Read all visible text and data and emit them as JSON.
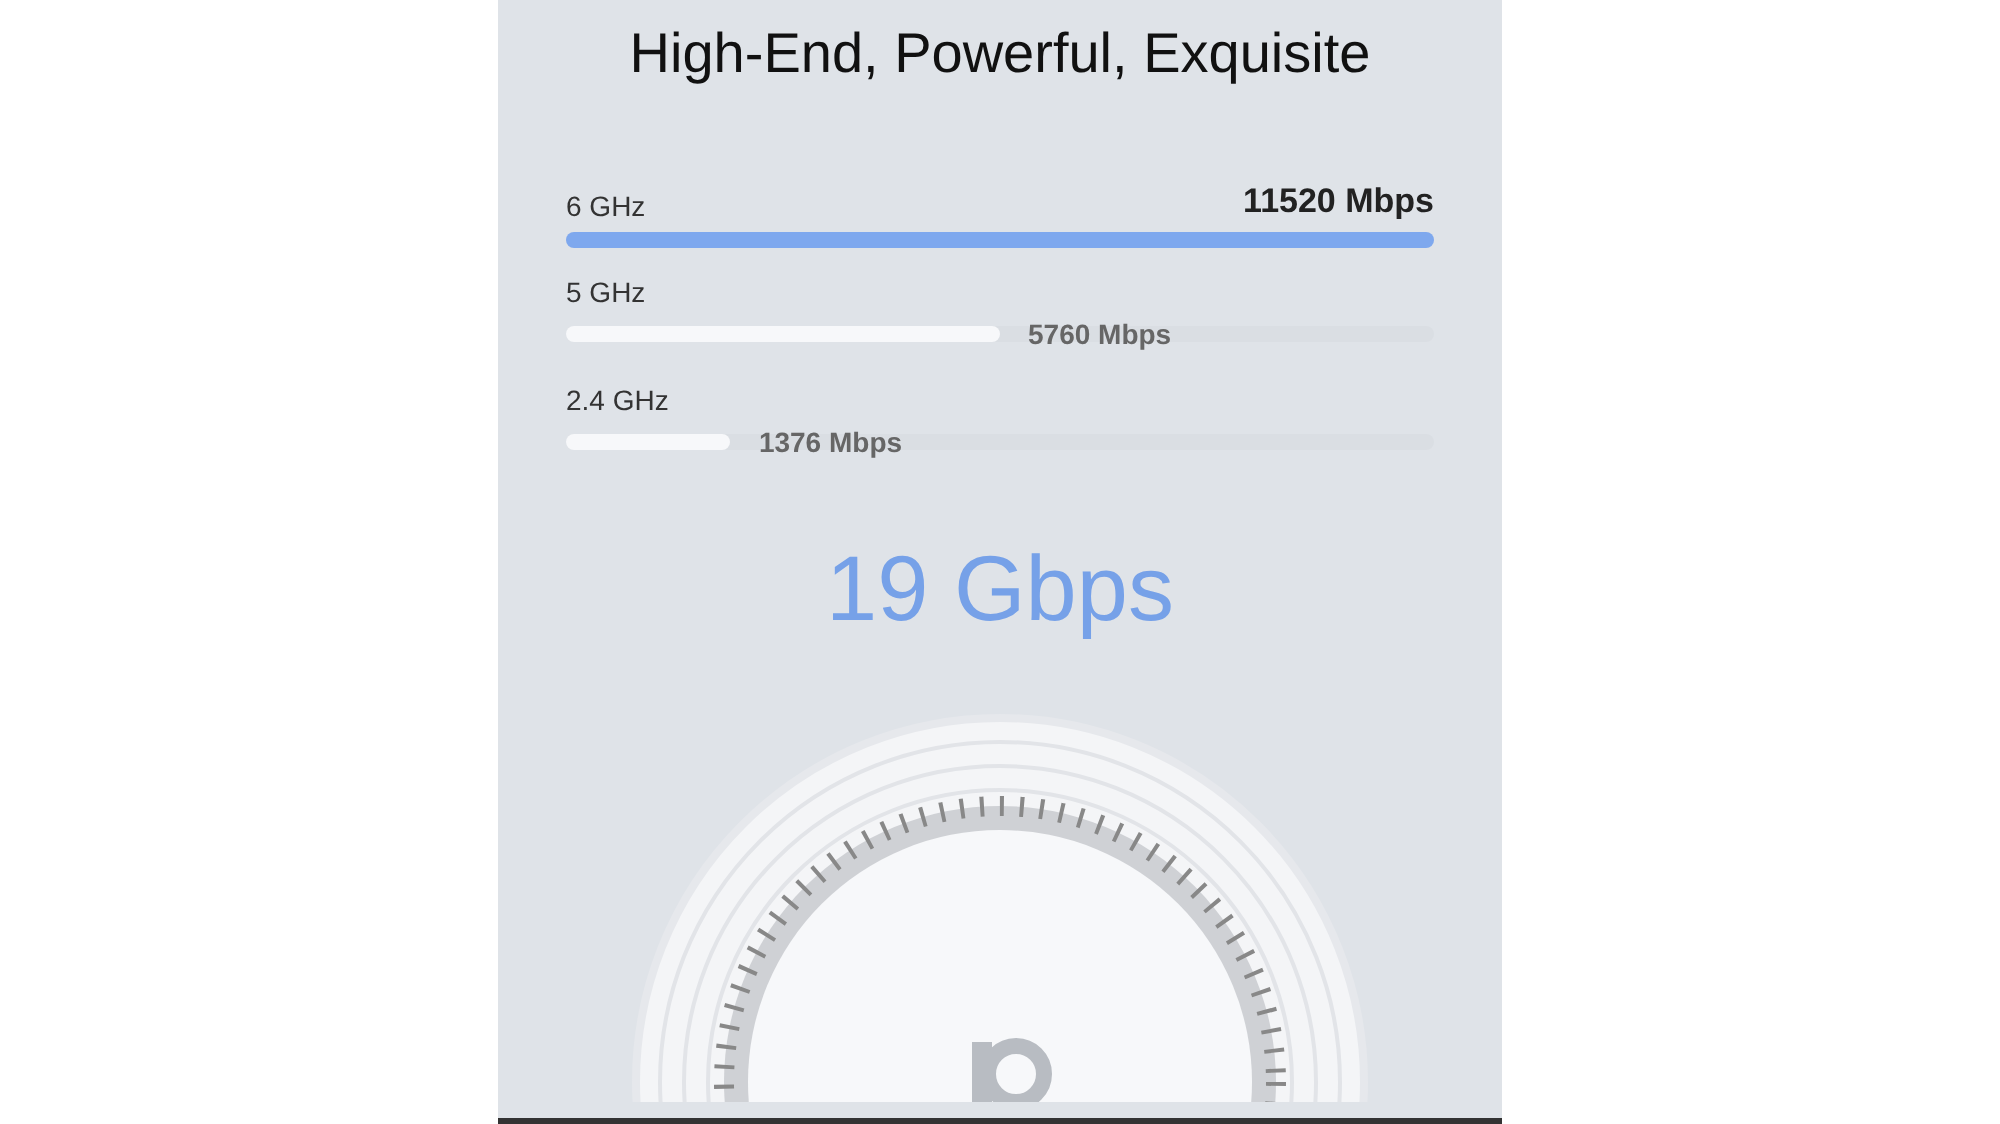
{
  "title": "High-End, Powerful, Exquisite",
  "bands": [
    {
      "label": "6 GHz",
      "reading": "11520 Mbps",
      "level": 1,
      "highlighted": true
    },
    {
      "label": "5 GHz",
      "reading": "5760 Mbps",
      "level": 0.5,
      "highlighted": false
    },
    {
      "label": "2.4 GHz",
      "reading": "1376 Mbps",
      "level": 0.19,
      "highlighted": false
    }
  ],
  "total": "19 Gbps"
}
